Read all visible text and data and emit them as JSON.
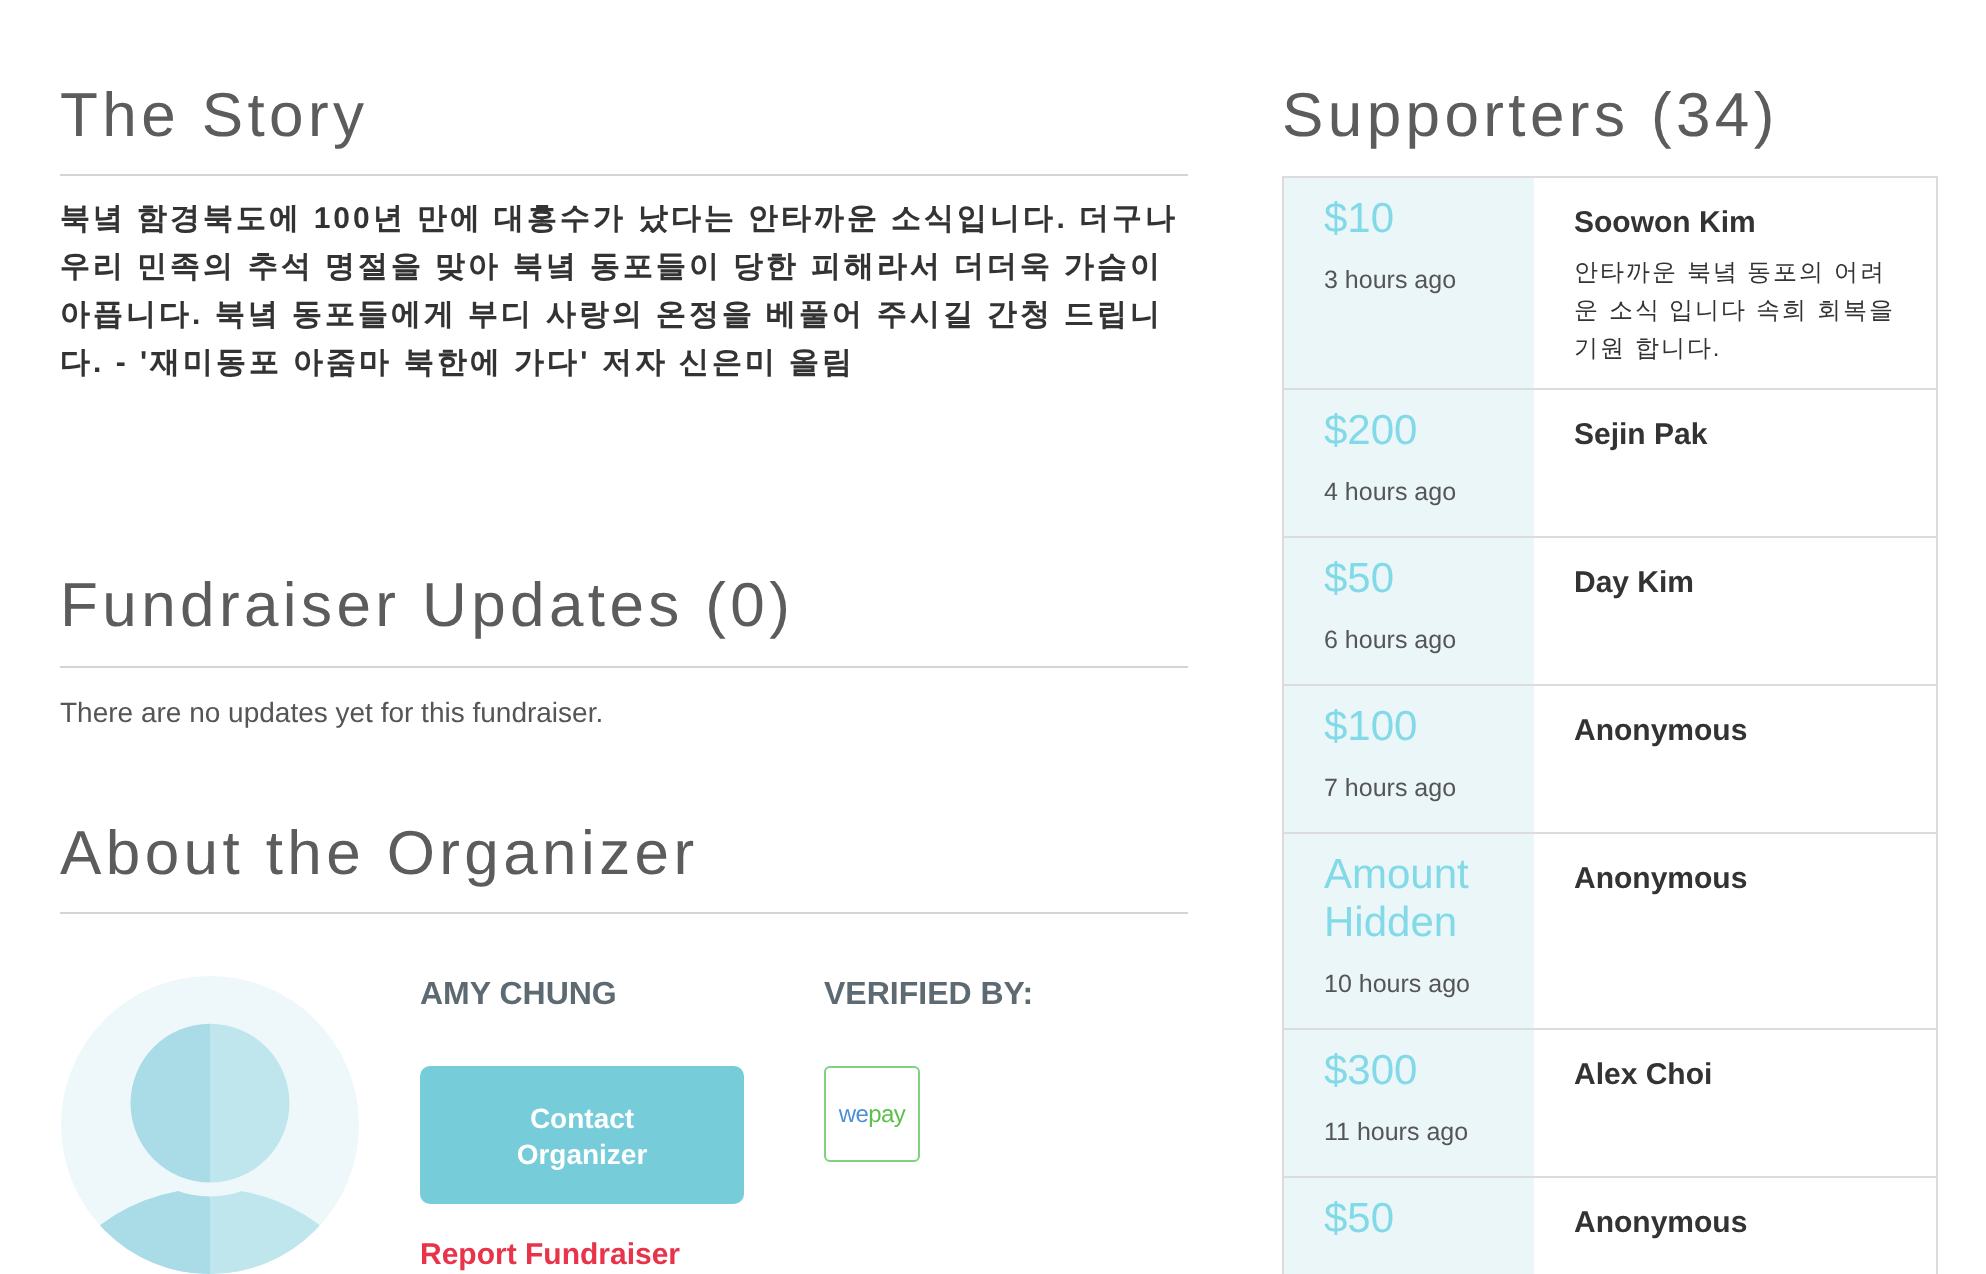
{
  "story": {
    "title": "The Story",
    "text": "북녘 함경북도에 100년 만에 대홍수가 났다는 안타까운 소식입니다. 더구나 우리 민족의 추석 명절을 맞아 북녘 동포들이 당한 피해라서 더더욱 가슴이 아픕니다. 북녘 동포들에게 부디 사랑의 온정을 베풀어 주시길 간청 드립니다. - '재미동포 아줌마 북한에 가다' 저자 신은미 올림"
  },
  "updates": {
    "title": "Fundraiser Updates (0)",
    "empty_message": "There are no updates yet for this fundraiser."
  },
  "organizer": {
    "title": "About the Organizer",
    "name": "AMY CHUNG",
    "verified_label": "VERIFIED BY:",
    "contact_button": "Contact Organizer",
    "verifier_logo_parts": [
      "we",
      "pay"
    ],
    "report_link": "Report Fundraiser"
  },
  "supporters": {
    "title": "Supporters (34)",
    "items": [
      {
        "amount": "$10",
        "time": "3 hours ago",
        "name": "Soowon Kim",
        "message": "안타까운 북녘 동포의 어려운 소식 입니다 속희 회복을 기원 합니다."
      },
      {
        "amount": "$200",
        "time": "4 hours ago",
        "name": "Sejin Pak"
      },
      {
        "amount": "$50",
        "time": "6 hours ago",
        "name": "Day Kim"
      },
      {
        "amount": "$100",
        "time": "7 hours ago",
        "name": "Anonymous"
      },
      {
        "amount": "Amount Hidden",
        "time": "10 hours ago",
        "name": "Anonymous"
      },
      {
        "amount": "$300",
        "time": "11 hours ago",
        "name": "Alex Choi"
      },
      {
        "amount": "$50",
        "name": "Anonymous"
      }
    ]
  }
}
